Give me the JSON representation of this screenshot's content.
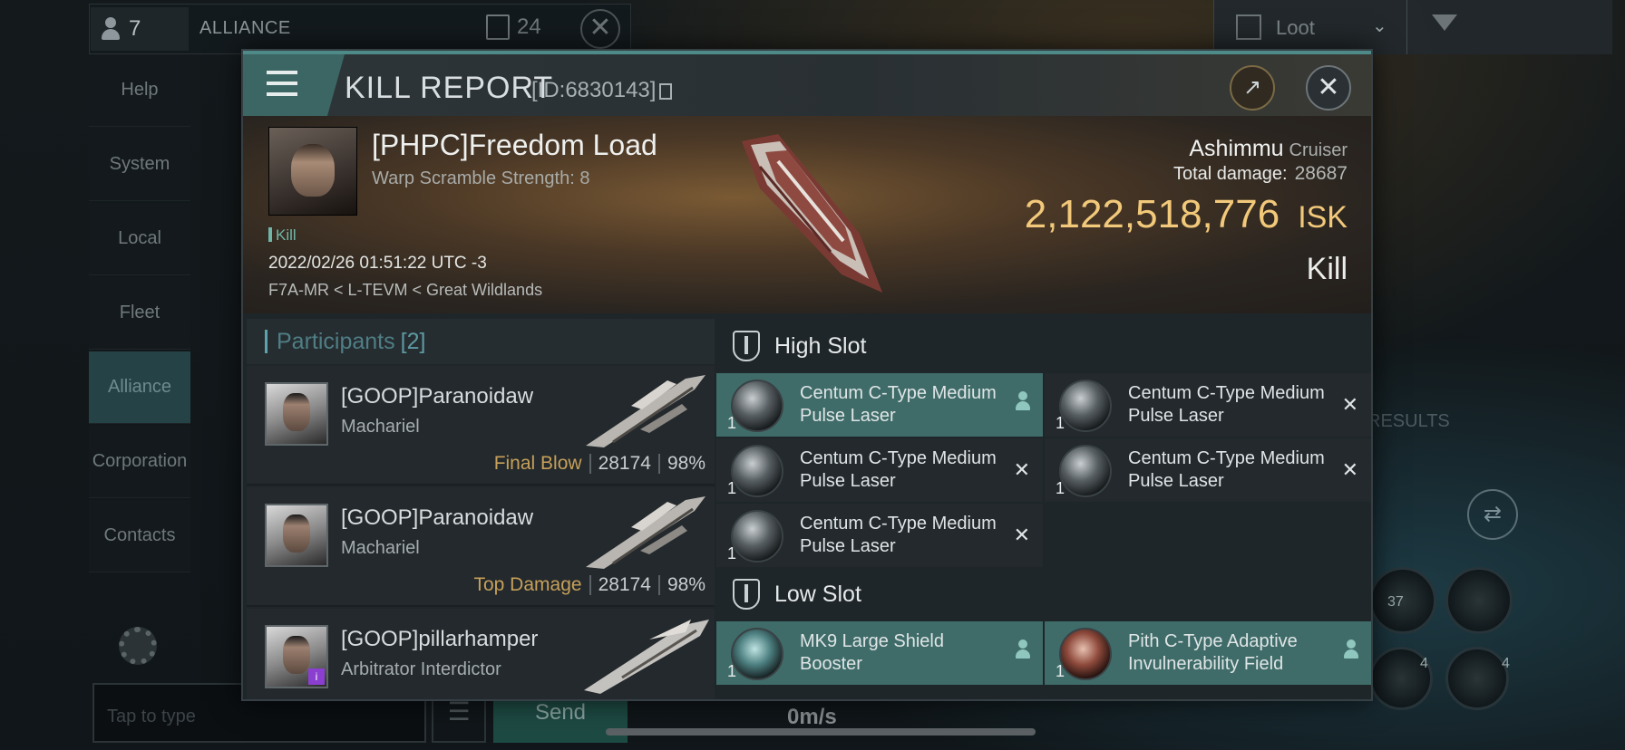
{
  "background": {
    "member_count": "7",
    "channel_label": "ALLIANCE",
    "doc_count": "24",
    "sidebar": [
      "Help",
      "System",
      "Local",
      "Fleet",
      "Alliance",
      "Corporation",
      "Contacts"
    ],
    "active_sidebar": "Alliance",
    "chat_placeholder": "Tap to type",
    "send_label": "Send",
    "loot_filter": "Loot",
    "results_label": "RESULTS",
    "speed": "0m/s",
    "module_counts": [
      "37",
      "4",
      "4"
    ]
  },
  "kill_report": {
    "title": "KILL REPORT",
    "id": "[ID:6830143]",
    "victim": {
      "name": "[PHPC]Freedom Load",
      "warp_scramble": "Warp Scramble Strength: 8",
      "tag": "Kill",
      "datetime": "2022/02/26 01:51:22 UTC -3",
      "location": "F7A-MR < L-TEVM < Great Wildlands",
      "ship": "Ashimmu",
      "ship_class": "Cruiser",
      "total_damage_label": "Total damage:",
      "total_damage": "28687",
      "isk_value": "2,122,518,776",
      "isk_unit": "ISK",
      "result": "Kill"
    },
    "participants": {
      "label": "Participants",
      "count": "[2]",
      "rows": [
        {
          "name": "[GOOP]Paranoidaw",
          "ship": "Machariel",
          "role": "Final Blow",
          "damage": "28174",
          "percent": "98%"
        },
        {
          "name": "[GOOP]Paranoidaw",
          "ship": "Machariel",
          "role": "Top Damage",
          "damage": "28174",
          "percent": "98%"
        },
        {
          "name": "[GOOP]pillarhamper",
          "ship": "Arbitrator Interdictor",
          "role": "",
          "damage": "",
          "percent": ""
        }
      ]
    },
    "high_slot": {
      "label": "High Slot",
      "items": [
        {
          "qty": "1",
          "name": "Centum C-Type Medium Pulse Laser",
          "state": "dropped"
        },
        {
          "qty": "1",
          "name": "Centum C-Type Medium Pulse Laser",
          "state": "destroyed"
        },
        {
          "qty": "1",
          "name": "Centum C-Type Medium Pulse Laser",
          "state": "destroyed"
        },
        {
          "qty": "1",
          "name": "Centum C-Type Medium Pulse Laser",
          "state": "destroyed"
        },
        {
          "qty": "1",
          "name": "Centum C-Type Medium Pulse Laser",
          "state": "destroyed"
        }
      ]
    },
    "low_slot": {
      "label": "Low Slot",
      "items": [
        {
          "qty": "1",
          "name": "MK9 Large Shield Booster",
          "state": "dropped"
        },
        {
          "qty": "1",
          "name": "Pith C-Type Adaptive Invulnerability Field",
          "state": "dropped"
        }
      ]
    }
  },
  "colors": {
    "accent": "#3f6c69",
    "isk": "#f2c97a",
    "role": "#c7a05a"
  }
}
